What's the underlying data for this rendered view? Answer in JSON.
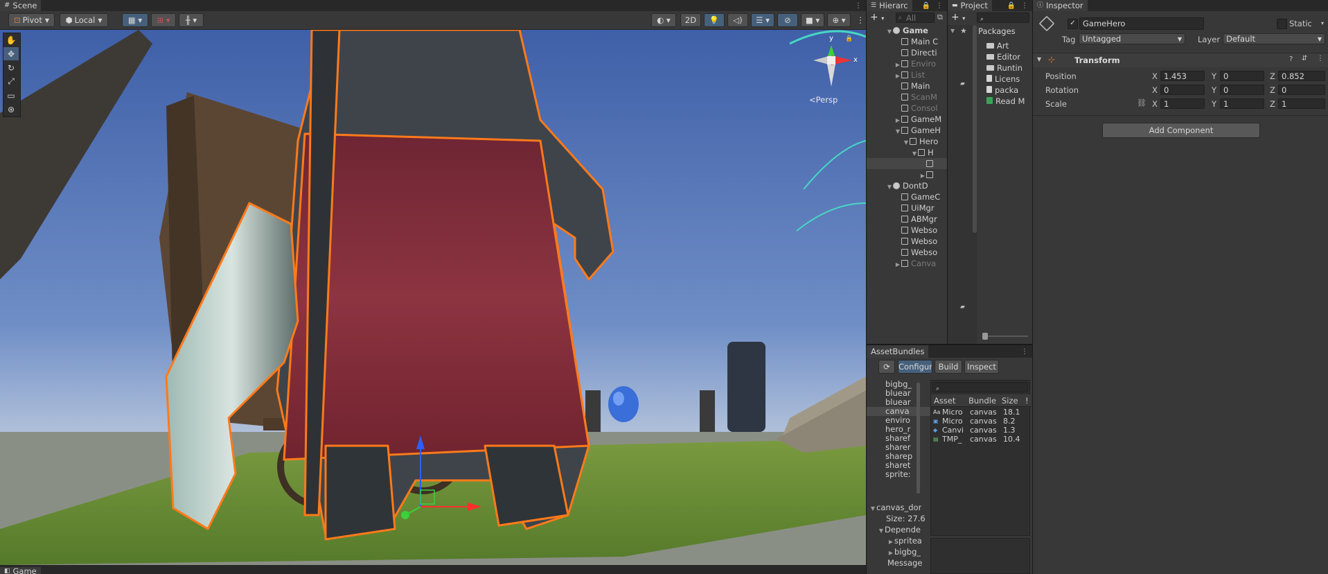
{
  "scene": {
    "tab": "Scene",
    "pivot": "Pivot",
    "local": "Local",
    "mode_2d": "2D",
    "persp": "Persp",
    "gizmo_y": "y",
    "gizmo_x": "x",
    "tools": [
      "hand-tool",
      "move-tool",
      "rotate-tool",
      "scale-tool",
      "rect-tool",
      "transform-tool"
    ]
  },
  "game_tab": "Game",
  "hierarchy": {
    "tab": "Hierarc",
    "search_placeholder": "All",
    "items": [
      {
        "label": "Game",
        "level": 0,
        "arrow": "▼",
        "icon": "scene",
        "dim": false,
        "bold": true
      },
      {
        "label": "Main C",
        "level": 1,
        "arrow": "",
        "icon": "cube",
        "dim": false
      },
      {
        "label": "Directi",
        "level": 1,
        "arrow": "",
        "icon": "cube",
        "dim": false
      },
      {
        "label": "Enviro",
        "level": 1,
        "arrow": "▶",
        "icon": "cube",
        "dim": true
      },
      {
        "label": "List",
        "level": 1,
        "arrow": "▶",
        "icon": "cube",
        "dim": true
      },
      {
        "label": "Main",
        "level": 1,
        "arrow": "",
        "icon": "cube",
        "dim": false
      },
      {
        "label": "ScanM",
        "level": 1,
        "arrow": "",
        "icon": "cube",
        "dim": true
      },
      {
        "label": "Consol",
        "level": 1,
        "arrow": "",
        "icon": "cube",
        "dim": true
      },
      {
        "label": "GameM",
        "level": 1,
        "arrow": "▶",
        "icon": "cube",
        "dim": false
      },
      {
        "label": "GameH",
        "level": 1,
        "arrow": "▼",
        "icon": "cube",
        "dim": false
      },
      {
        "label": "Hero",
        "level": 2,
        "arrow": "▼",
        "icon": "cube",
        "dim": false
      },
      {
        "label": "H",
        "level": 3,
        "arrow": "▼",
        "icon": "cube",
        "dim": false
      },
      {
        "label": "",
        "level": 4,
        "arrow": "",
        "icon": "cube",
        "dim": false
      },
      {
        "label": "",
        "level": 4,
        "arrow": "▶",
        "icon": "cube",
        "dim": false
      },
      {
        "label": "DontD",
        "level": 0,
        "arrow": "▼",
        "icon": "scene",
        "dim": false
      },
      {
        "label": "GameC",
        "level": 1,
        "arrow": "",
        "icon": "cube",
        "dim": false
      },
      {
        "label": "UiMgr",
        "level": 1,
        "arrow": "",
        "icon": "cube",
        "dim": false
      },
      {
        "label": "ABMgr",
        "level": 1,
        "arrow": "",
        "icon": "cube",
        "dim": false
      },
      {
        "label": "Webso",
        "level": 1,
        "arrow": "",
        "icon": "cube",
        "dim": false
      },
      {
        "label": "Webso",
        "level": 1,
        "arrow": "",
        "icon": "cube",
        "dim": false
      },
      {
        "label": "Webso",
        "level": 1,
        "arrow": "",
        "icon": "cube",
        "dim": false
      },
      {
        "label": "Canva",
        "level": 1,
        "arrow": "▶",
        "icon": "cube",
        "dim": true
      }
    ]
  },
  "project": {
    "tab": "Project",
    "breadcrumb": "Packages",
    "items": [
      {
        "label": "Art",
        "icon": "folder"
      },
      {
        "label": "Editor",
        "icon": "folder"
      },
      {
        "label": "Runtin",
        "icon": "folder"
      },
      {
        "label": "Licens",
        "icon": "file"
      },
      {
        "label": "packa",
        "icon": "file"
      },
      {
        "label": "Read M",
        "icon": "readme"
      }
    ]
  },
  "inspector": {
    "tab": "Inspector",
    "object_name": "GameHero",
    "static_label": "Static",
    "tag_label": "Tag",
    "tag_value": "Untagged",
    "layer_label": "Layer",
    "layer_value": "Default",
    "transform_title": "Transform",
    "position_label": "Position",
    "rotation_label": "Rotation",
    "scale_label": "Scale",
    "x_label": "X",
    "y_label": "Y",
    "z_label": "Z",
    "position": {
      "x": "1.453",
      "y": "0",
      "z": "0.852"
    },
    "rotation": {
      "x": "0",
      "y": "0",
      "z": "0"
    },
    "scale": {
      "x": "1",
      "y": "1",
      "z": "1"
    },
    "add_component": "Add Component"
  },
  "assetbundles": {
    "tab": "AssetBundles",
    "configure": "Configure",
    "build": "Build",
    "inspect": "Inspect",
    "bundle_list": [
      {
        "label": "bigbg_",
        "sel": false
      },
      {
        "label": "bluear",
        "sel": false
      },
      {
        "label": "bluear",
        "sel": false
      },
      {
        "label": "canva",
        "sel": true
      },
      {
        "label": "enviro",
        "sel": false
      },
      {
        "label": "hero_r",
        "sel": false
      },
      {
        "label": "sharef",
        "sel": false
      },
      {
        "label": "sharer",
        "sel": false
      },
      {
        "label": "sharep",
        "sel": false
      },
      {
        "label": "sharet",
        "sel": false
      },
      {
        "label": "sprite:",
        "sel": false
      }
    ],
    "headers": {
      "asset": "Asset",
      "bundle": "Bundle",
      "size": "Size"
    },
    "rows": [
      {
        "icon": "Aa",
        "asset": "Micro",
        "bundle": "canvas",
        "size": "18.1"
      },
      {
        "icon": "img",
        "asset": "Micro",
        "bundle": "canvas",
        "size": "8.2"
      },
      {
        "icon": "cube",
        "asset": "Canvi",
        "bundle": "canvas",
        "size": "1.3"
      },
      {
        "icon": "script",
        "asset": "TMP_",
        "bundle": "canvas",
        "size": "10.4"
      }
    ],
    "details": {
      "bundle_name": "canvas_dor",
      "size_line": "Size: 27.6",
      "dependencies": "Depende",
      "dep_items": [
        "spritea",
        "bigbg_"
      ],
      "message": "Message"
    }
  },
  "colors": {
    "selection_outline": "#ff7a1a",
    "accent_blue": "#46607c",
    "panel_bg": "#383838"
  }
}
